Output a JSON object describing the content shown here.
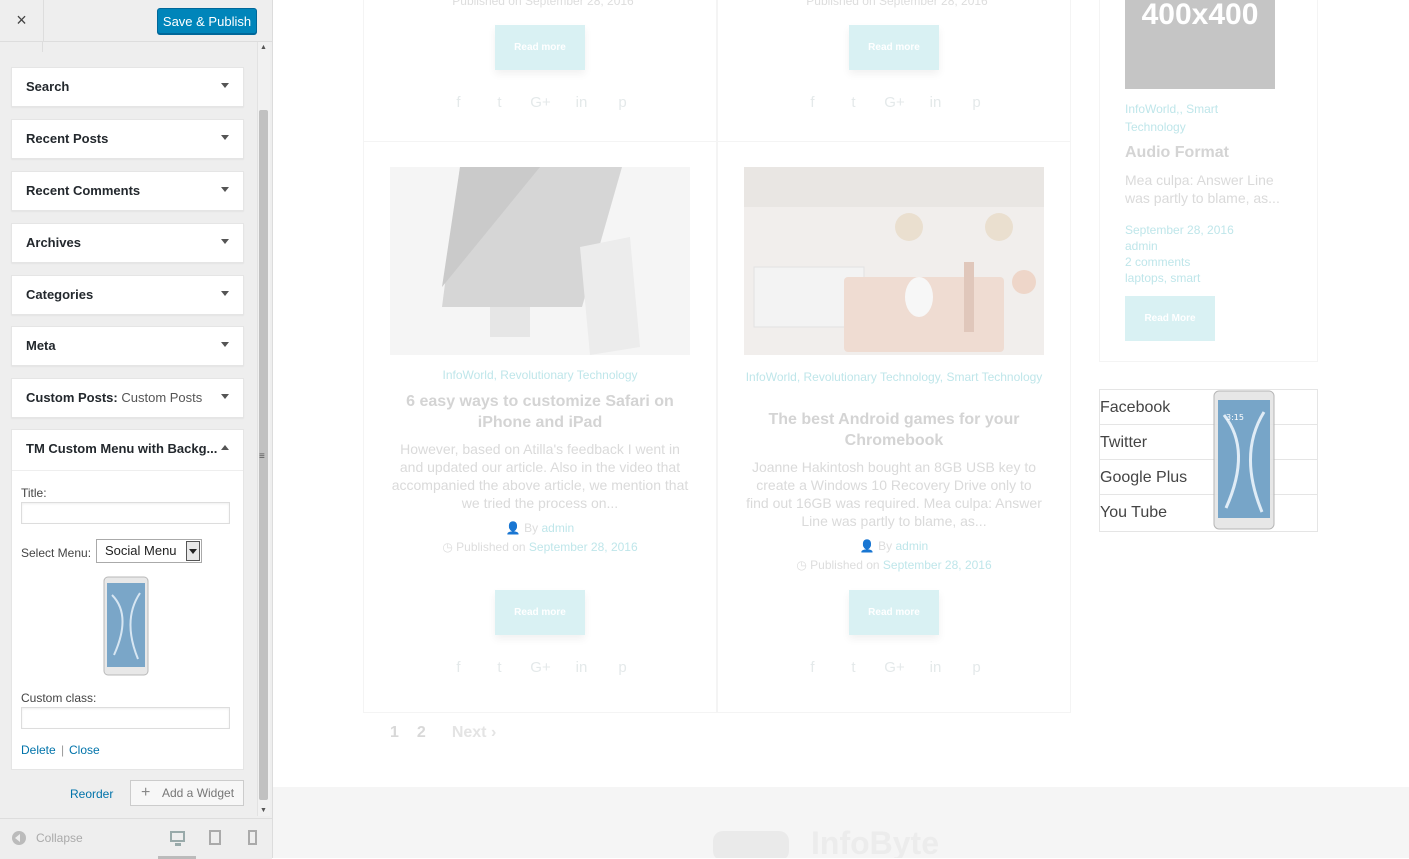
{
  "sidebar": {
    "close_label": "×",
    "publish_label": "Save & Publish",
    "widgets": [
      {
        "title": "Search"
      },
      {
        "title": "Recent Posts"
      },
      {
        "title": "Recent Comments"
      },
      {
        "title": "Archives"
      },
      {
        "title": "Categories"
      },
      {
        "title": "Meta"
      },
      {
        "title": "Custom Posts:",
        "sub": "Custom Posts"
      }
    ],
    "open_widget": {
      "title": "TM Custom Menu with Backg...",
      "title_label": "Title:",
      "title_value": "",
      "select_label": "Select Menu:",
      "select_value": "Social Menu",
      "custom_class_label": "Custom class:",
      "custom_class_value": "",
      "delete_label": "Delete",
      "separator": "|",
      "close_label": "Close"
    },
    "reorder_label": "Reorder",
    "add_widget_label": "Add a Widget",
    "collapse_label": "Collapse"
  },
  "preview": {
    "top_meta_left": "Published on September 28, 2016",
    "top_meta_right": "Published on September 28, 2016",
    "read_more": "Read more",
    "posts": [
      {
        "categories": "InfoWorld, Revolutionary Technology",
        "title": "6 easy ways to customize Safari on iPhone and iPad",
        "excerpt": "However, based on Atilla's feedback I went in and updated our article. Also in the video that accompanied the above article, we mention that we tried the process on...",
        "by": "By",
        "author": "admin",
        "published": "Published on",
        "date": "September 28, 2016"
      },
      {
        "categories": "InfoWorld, Revolutionary Technology, Smart Technology",
        "title": "The best Android games for your Chromebook",
        "excerpt": "Joanne Hakintosh bought an 8GB USB key to create a Windows 10 Recovery Drive only to find out 16GB was required. Mea culpa: Answer Line was partly to blame, as...",
        "by": "By",
        "author": "admin",
        "published": "Published on",
        "date": "September 28, 2016"
      }
    ],
    "pagination": {
      "p1": "1",
      "p2": "2",
      "next": "Next ›"
    },
    "right_column": {
      "image_label": "400x400",
      "categories": "InfoWorld,, Smart Technology",
      "title": "Audio Format",
      "excerpt": "Mea culpa: Answer Line was partly to blame, as...",
      "date": "September 28, 2016",
      "author": "admin",
      "comments": "2 comments",
      "tags": "laptops, smart",
      "read_more": "Read More"
    },
    "social_menu": [
      "Facebook",
      "Twitter",
      "Google Plus",
      "You Tube"
    ],
    "footer_logo": "InfoByte"
  }
}
